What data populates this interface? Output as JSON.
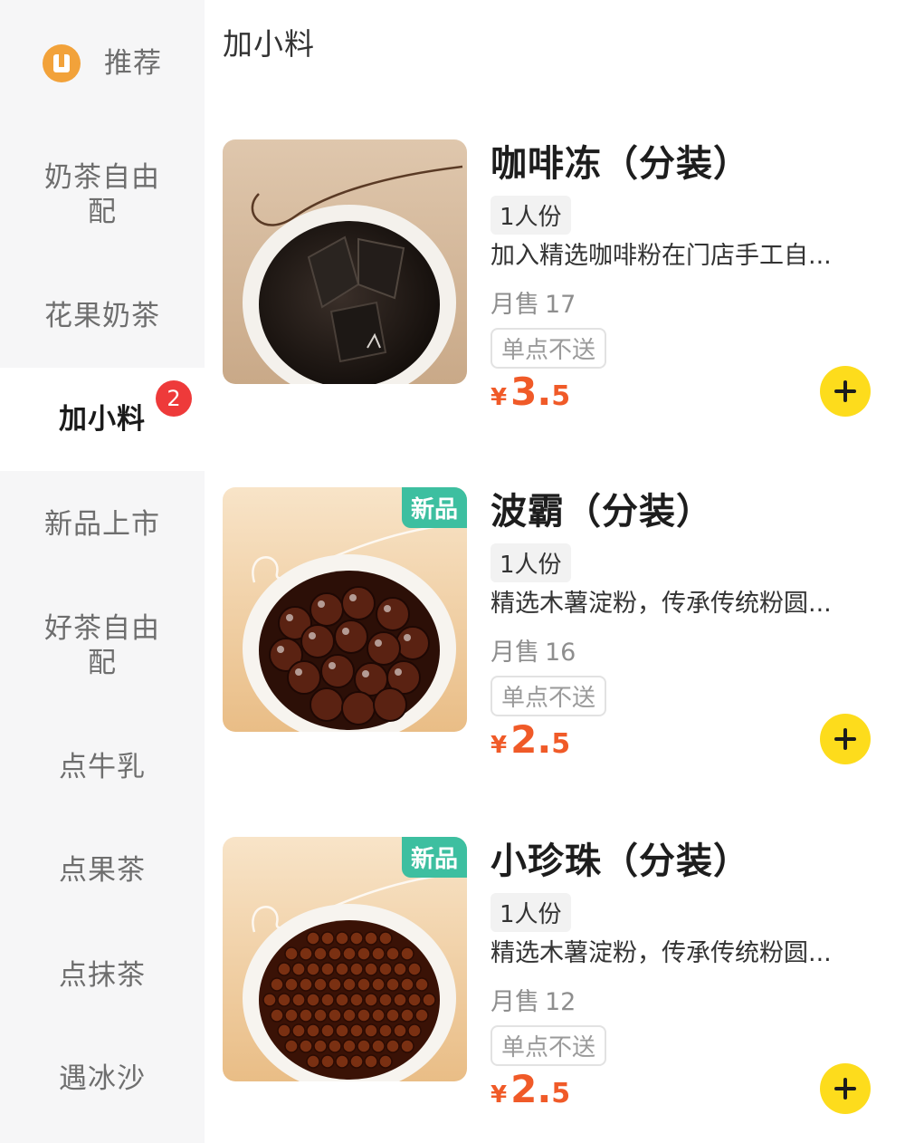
{
  "sidebar": {
    "items": [
      {
        "label": "推荐",
        "icon": "recommend-icon"
      },
      {
        "label": "奶茶自由配"
      },
      {
        "label": "花果奶茶"
      },
      {
        "label": "加小料",
        "badge": "2",
        "active": true
      },
      {
        "label": "新品上市"
      },
      {
        "label": "好茶自由配"
      },
      {
        "label": "点牛乳"
      },
      {
        "label": "点果茶"
      },
      {
        "label": "点抹茶"
      },
      {
        "label": "遇冰沙"
      }
    ]
  },
  "main": {
    "category_title": "加小料",
    "products": [
      {
        "name": "咖啡冻（分装）",
        "portion": "1人份",
        "description": "加入精选咖啡粉在门店手工自...",
        "sales_label": "月售",
        "sales_count": "17",
        "tag_no_solo": "单点不送",
        "currency": "¥",
        "price_int": "3.",
        "price_dec": "5",
        "new_tag": ""
      },
      {
        "name": "波霸（分装）",
        "portion": "1人份",
        "description": "精选木薯淀粉，传承传统粉圆...",
        "sales_label": "月售",
        "sales_count": "16",
        "tag_no_solo": "单点不送",
        "currency": "¥",
        "price_int": "2.",
        "price_dec": "5",
        "new_tag": "新品"
      },
      {
        "name": "小珍珠（分装）",
        "portion": "1人份",
        "description": "精选木薯淀粉，传承传统粉圆...",
        "sales_label": "月售",
        "sales_count": "12",
        "tag_no_solo": "单点不送",
        "currency": "¥",
        "price_int": "2.",
        "price_dec": "5",
        "new_tag": "新品"
      }
    ]
  },
  "colors": {
    "price": "#f05a28",
    "add_button": "#fddc1c",
    "badge": "#ee3a3a",
    "new_tag": "#3dbfa0"
  }
}
